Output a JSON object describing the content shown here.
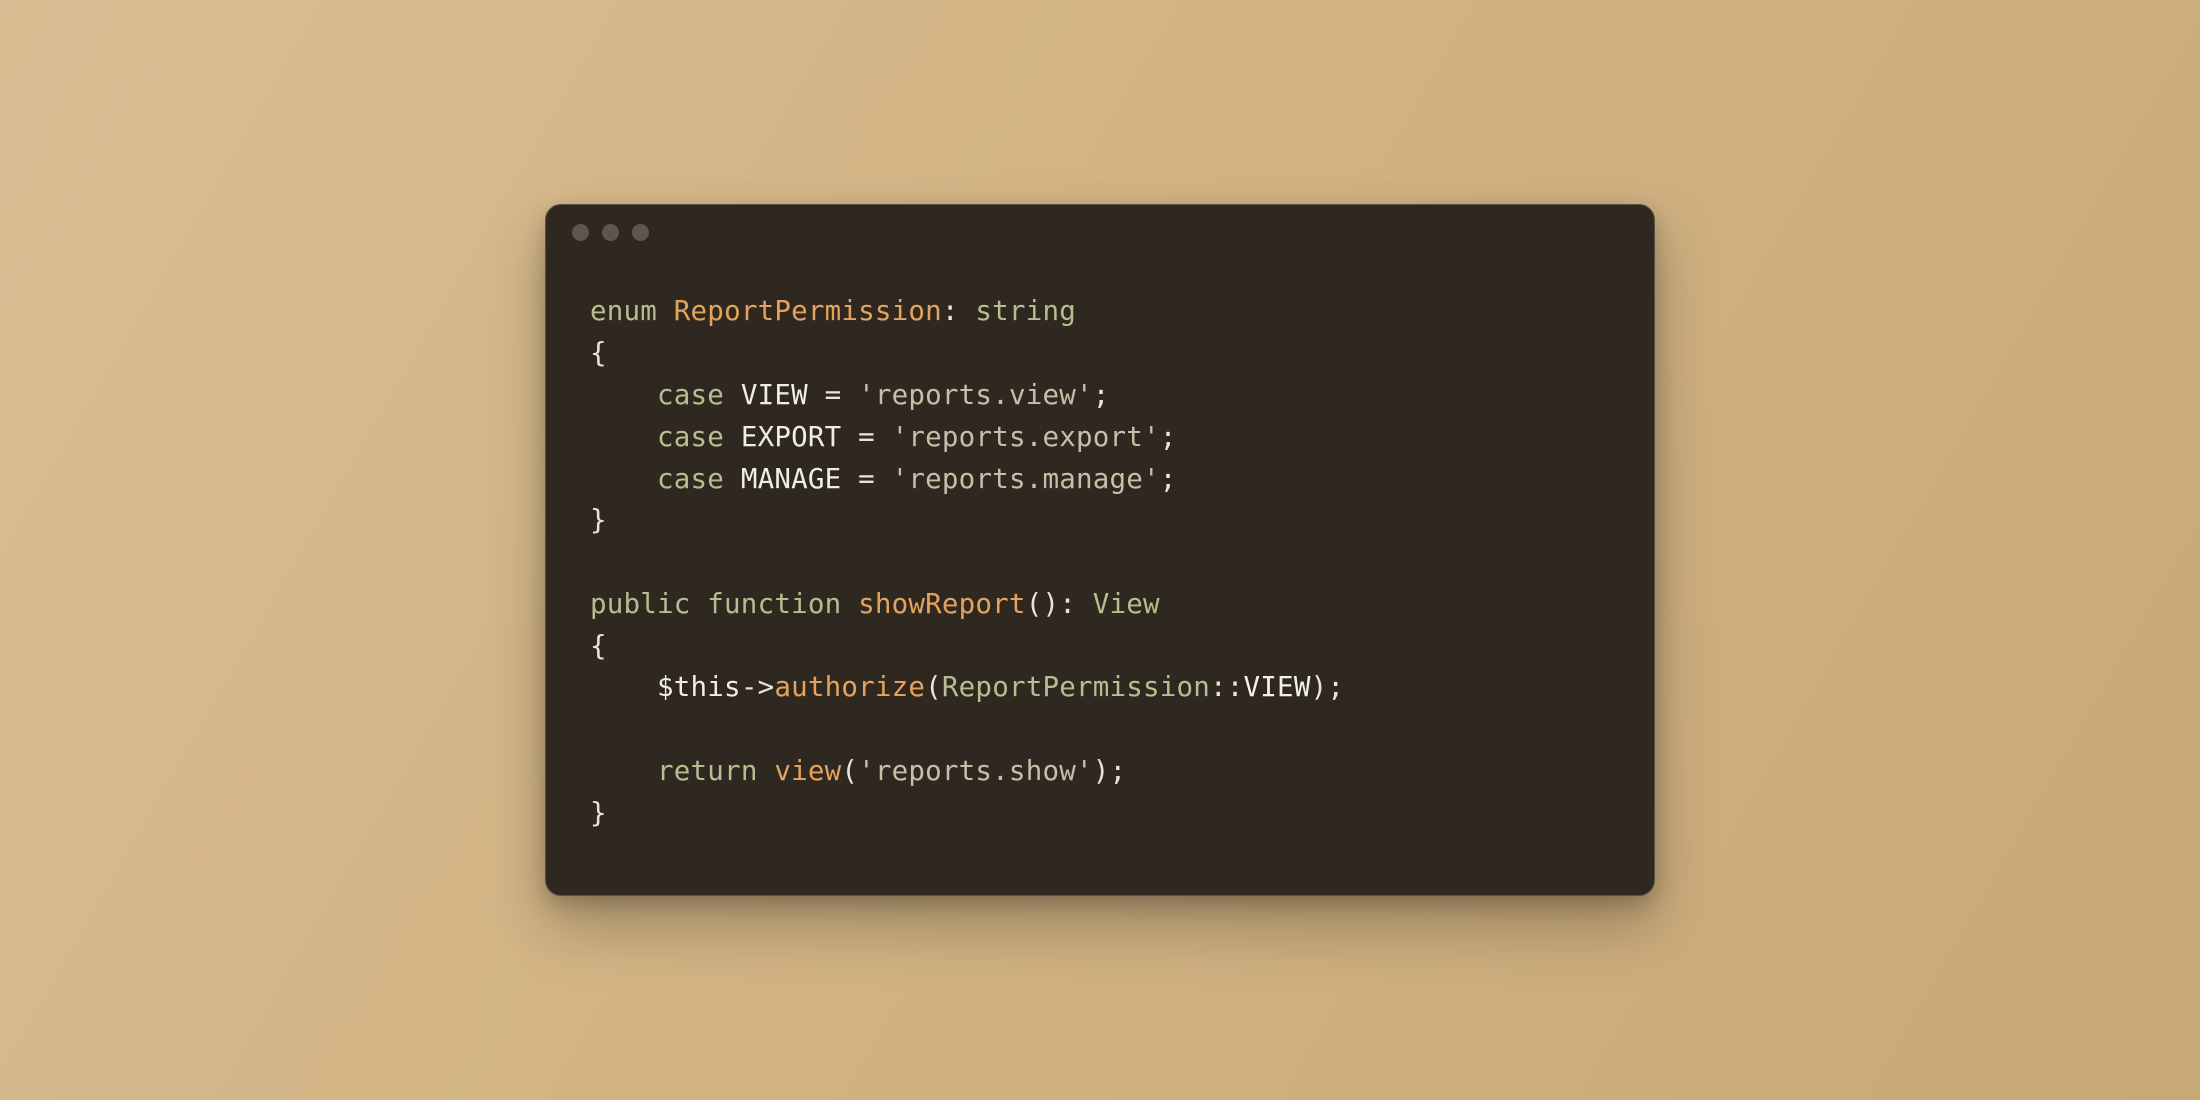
{
  "code": {
    "l1_kw": "enum ",
    "l1_type": "ReportPermission",
    "l1_colon": ": ",
    "l1_rt": "string",
    "l2": "{",
    "l3_indent": "    ",
    "l3_kw": "case ",
    "l3_name": "VIEW",
    "l3_eq": " = ",
    "l3_str": "'reports.view'",
    "l3_semi": ";",
    "l4_indent": "    ",
    "l4_kw": "case ",
    "l4_name": "EXPORT",
    "l4_eq": " = ",
    "l4_str": "'reports.export'",
    "l4_semi": ";",
    "l5_indent": "    ",
    "l5_kw": "case ",
    "l5_name": "MANAGE",
    "l5_eq": " = ",
    "l5_str": "'reports.manage'",
    "l5_semi": ";",
    "l6": "}",
    "blank": "",
    "l8_kw1": "public ",
    "l8_kw2": "function ",
    "l8_fn": "showReport",
    "l8_par": "()",
    "l8_colon": ": ",
    "l8_rt": "View",
    "l9": "{",
    "l10_indent": "    ",
    "l10_this": "$this",
    "l10_arrow": "->",
    "l10_call": "authorize",
    "l10_op": "(",
    "l10_cls": "ReportPermission",
    "l10_scope": "::",
    "l10_const": "VIEW",
    "l10_cp": ")",
    "l10_semi": ";",
    "l12_indent": "    ",
    "l12_kw": "return ",
    "l12_call": "view",
    "l12_op": "(",
    "l12_str": "'reports.show'",
    "l12_cp": ")",
    "l12_semi": ";",
    "l13": "}"
  }
}
